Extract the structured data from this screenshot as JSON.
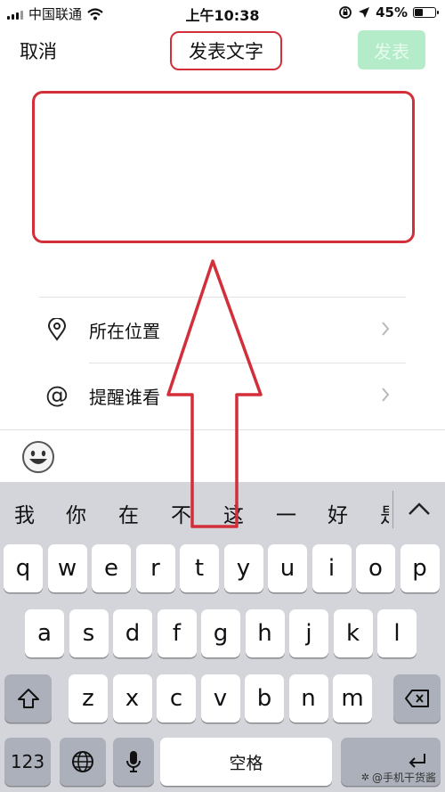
{
  "status_bar": {
    "carrier": "中国联通",
    "time": "上午10:38",
    "battery": "45%",
    "battery_level": 0.45
  },
  "nav": {
    "cancel": "取消",
    "title": "发表文字",
    "publish": "发表"
  },
  "textarea": {
    "value": "",
    "placeholder": ""
  },
  "options": [
    {
      "label": "所在位置",
      "icon": "location-pin-icon"
    },
    {
      "label": "提醒谁看",
      "icon": "at-icon"
    }
  ],
  "keyboard": {
    "candidates": [
      "我",
      "你",
      "在",
      "不",
      "这",
      "一",
      "好",
      "是"
    ],
    "row1": [
      "q",
      "w",
      "e",
      "r",
      "t",
      "y",
      "u",
      "i",
      "o",
      "p"
    ],
    "row2": [
      "a",
      "s",
      "d",
      "f",
      "g",
      "h",
      "j",
      "k",
      "l"
    ],
    "row3": [
      "z",
      "x",
      "c",
      "v",
      "b",
      "n",
      "m"
    ],
    "numbers": "123",
    "space": "空格"
  },
  "watermark": "@手机干货酱",
  "colors": {
    "annotation": "#d32f3a",
    "publish_disabled": "#b4ecc9"
  }
}
